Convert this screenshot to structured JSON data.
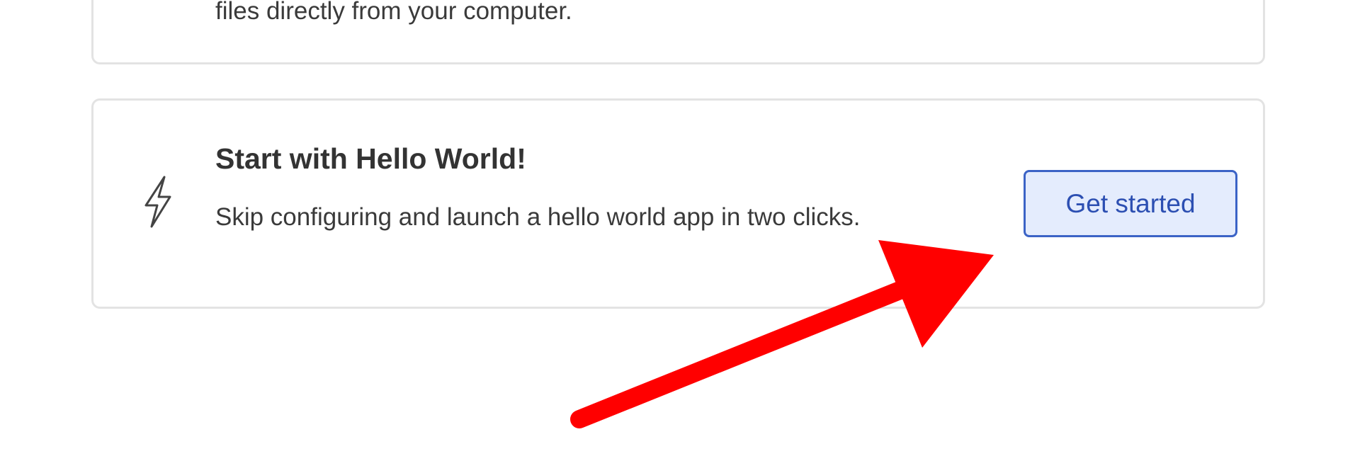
{
  "previous_card": {
    "description_tail": "files directly from your computer."
  },
  "hello_world_card": {
    "icon": "lightning-bolt-icon",
    "title": "Start with Hello World!",
    "description": "Skip configuring and launch a hello world app in two clicks.",
    "button_label": "Get started"
  },
  "annotation": {
    "type": "arrow",
    "color": "#ff0000"
  }
}
